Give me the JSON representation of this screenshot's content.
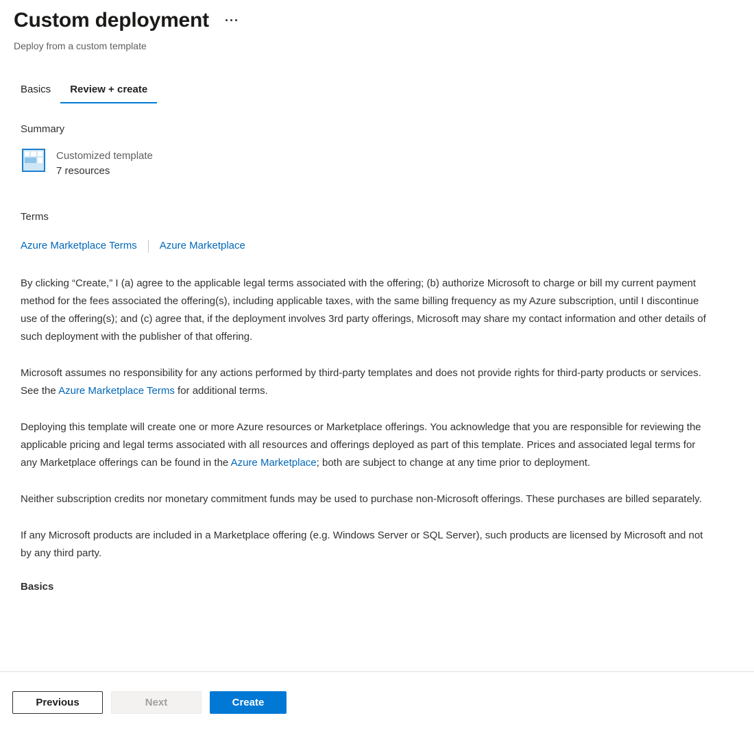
{
  "header": {
    "title": "Custom deployment",
    "subtitle": "Deploy from a custom template",
    "more_menu_label": "More options"
  },
  "tabs": [
    {
      "label": "Basics",
      "active": false
    },
    {
      "label": "Review + create",
      "active": true
    }
  ],
  "summary": {
    "heading": "Summary",
    "icon": "template-grid-icon",
    "template_name": "Customized template",
    "resource_count": "7 resources"
  },
  "terms": {
    "heading": "Terms",
    "links": [
      {
        "label": "Azure Marketplace Terms"
      },
      {
        "label": "Azure Marketplace"
      }
    ],
    "paragraphs": {
      "p1": "By clicking “Create,” I (a) agree to the applicable legal terms associated with the offering; (b) authorize Microsoft to charge or bill my current payment method for the fees associated the offering(s), including applicable taxes, with the same billing frequency as my Azure subscription, until I discontinue use of the offering(s); and (c) agree that, if the deployment involves 3rd party offerings, Microsoft may share my contact information and other details of such deployment with the publisher of that offering.",
      "p2_before": "Microsoft assumes no responsibility for any actions performed by third-party templates and does not provide rights for third-party products or services. See the ",
      "p2_link": "Azure Marketplace Terms",
      "p2_after": " for additional terms.",
      "p3_before": "Deploying this template will create one or more Azure resources or Marketplace offerings.  You acknowledge that you are responsible for reviewing the applicable pricing and legal terms associated with all resources and offerings deployed as part of this template.  Prices and associated legal terms for any Marketplace offerings can be found in the ",
      "p3_link": "Azure Marketplace",
      "p3_after": "; both are subject to change at any time prior to deployment.",
      "p4": "Neither subscription credits nor monetary commitment funds may be used to purchase non-Microsoft offerings. These purchases are billed separately.",
      "p5": "If any Microsoft products are included in a Marketplace offering (e.g. Windows Server or SQL Server), such products are licensed by Microsoft and not by any third party."
    },
    "next_section_heading": "Basics"
  },
  "footer": {
    "previous_label": "Previous",
    "next_label": "Next",
    "create_label": "Create"
  },
  "colors": {
    "accent": "#0078d4",
    "link": "#0067b8",
    "text": "#323130",
    "muted": "#605e5c",
    "divider": "#e1dfdd"
  }
}
